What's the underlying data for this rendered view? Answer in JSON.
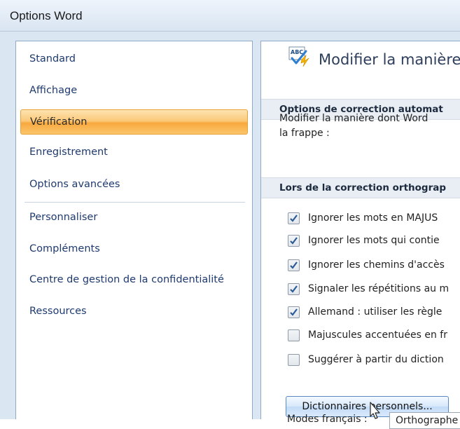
{
  "window": {
    "title": "Options Word"
  },
  "sidebar": {
    "items": [
      {
        "label": "Standard"
      },
      {
        "label": "Affichage"
      },
      {
        "label": "Vérification",
        "active": true
      },
      {
        "label": "Enregistrement"
      },
      {
        "label": "Options avancées"
      },
      {
        "label": "Personnaliser"
      },
      {
        "label": "Compléments"
      },
      {
        "label": "Centre de gestion de la confidentialité"
      },
      {
        "label": "Ressources"
      }
    ]
  },
  "content": {
    "header_title": "Modifier la manière",
    "header_icon": "abc-spellcheck-icon",
    "section_autocorrect": "Options de correction automat",
    "description_line1": "Modifier la manière dont Word",
    "description_line2": "la frappe :",
    "section_spelling": "Lors de la correction orthograp",
    "checkboxes": [
      {
        "label": "Ignorer les mots en MAJUS",
        "checked": true
      },
      {
        "label": "Ignorer les mots qui contie",
        "checked": true
      },
      {
        "label": "Ignorer les chemins d'accès",
        "checked": true
      },
      {
        "label": "Signaler les répétitions au m",
        "checked": true
      },
      {
        "label": "Allemand : utiliser les règle",
        "checked": true
      },
      {
        "label": "Majuscules accentuées en fr",
        "checked": false
      },
      {
        "label": "Suggérer à partir du diction",
        "checked": false
      }
    ],
    "dictionaries_button": "Dictionnaires personnels...",
    "modes_label": "Modes français :",
    "modes_value": "Orthographe"
  },
  "colors": {
    "active_item": "#fbc56b",
    "frame": "#dbe6f3",
    "link_text": "#1e3a6e"
  }
}
